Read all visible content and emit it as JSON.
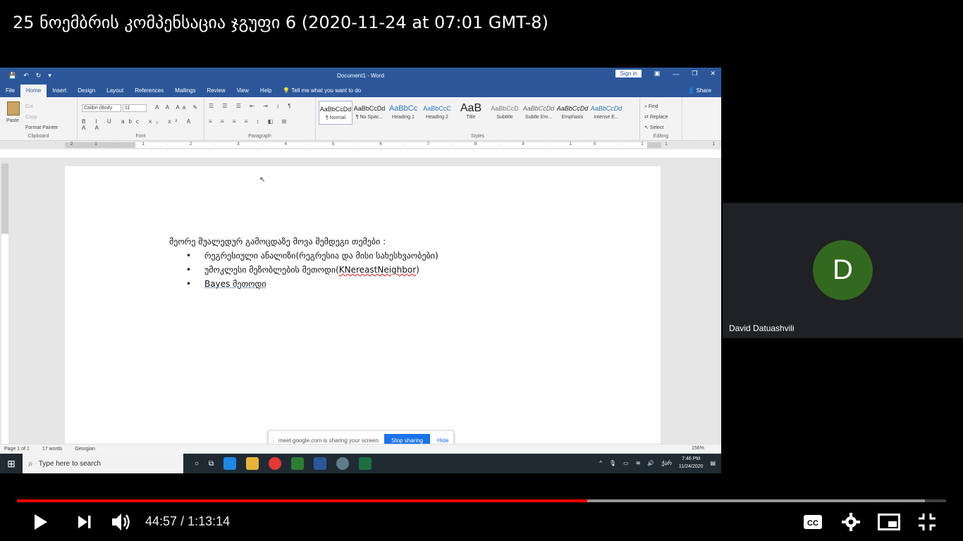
{
  "video": {
    "title": "25 ნოემბრის კომპენსაცია ჯგუფი 6 (2020-11-24 at 07:01 GMT-8)",
    "current_time": "44:57",
    "separator": "/",
    "duration": "1:13:14",
    "played_fraction": 0.614,
    "accent_color": "#ff0000"
  },
  "word": {
    "doc_title": "Document1 - Word",
    "sign_in": "Sign in",
    "menu": [
      "File",
      "Home",
      "Insert",
      "Design",
      "Layout",
      "References",
      "Mailings",
      "Review",
      "View",
      "Help"
    ],
    "tell_me": "Tell me what you want to do",
    "share": "Share",
    "clipboard": {
      "paste": "Paste",
      "cut": "Cut",
      "copy": "Copy",
      "format_painter": "Format Painter",
      "label": "Clipboard"
    },
    "font": {
      "name": "Calibri (Body",
      "size": "11",
      "label": "Font"
    },
    "paragraph": {
      "label": "Paragraph"
    },
    "styles": {
      "label": "Styles",
      "items": [
        {
          "sample": "AaBbCcDd",
          "name": "¶ Normal"
        },
        {
          "sample": "AaBbCcDd",
          "name": "¶ No Spac..."
        },
        {
          "sample": "AaBbCc",
          "name": "Heading 1"
        },
        {
          "sample": "AaBbCcC",
          "name": "Heading 2"
        },
        {
          "sample": "AaB",
          "name": "Title"
        },
        {
          "sample": "AaBbCcD",
          "name": "Subtitle"
        },
        {
          "sample": "AaBbCcDd",
          "name": "Subtle Em..."
        },
        {
          "sample": "AaBbCcDd",
          "name": "Emphasis"
        },
        {
          "sample": "AaBbCcDd",
          "name": "Intense E..."
        }
      ]
    },
    "editing": {
      "find": "Find",
      "replace": "Replace",
      "select": "Select",
      "label": "Editing"
    },
    "document": {
      "heading": "მეორე შუალედურ გამოცდაზე მოვა შემდეგი თემები :",
      "items": [
        "რეგრესიული ანალიზი(რეგრესია და  მისი სახესხვაობები)",
        "უმოკლესი მეზობლების მეთოდი(KNereastNeighbor)",
        "Bayes  მეთოდი"
      ]
    },
    "status": {
      "page": "Page 1 of 1",
      "words": "17 words",
      "language": "Georgian",
      "zoom": "156%"
    }
  },
  "meet": {
    "sharing_text": "meet.google.com is sharing your screen.",
    "stop_sharing": "Stop sharing",
    "hide": "Hide"
  },
  "taskbar": {
    "search_placeholder": "Type here to search",
    "time": "7:46 PM",
    "date": "11/24/2020",
    "lang": "ქარ"
  },
  "participant": {
    "initial": "D",
    "name": "David Datuashvili",
    "avatar_color": "#33691e"
  }
}
